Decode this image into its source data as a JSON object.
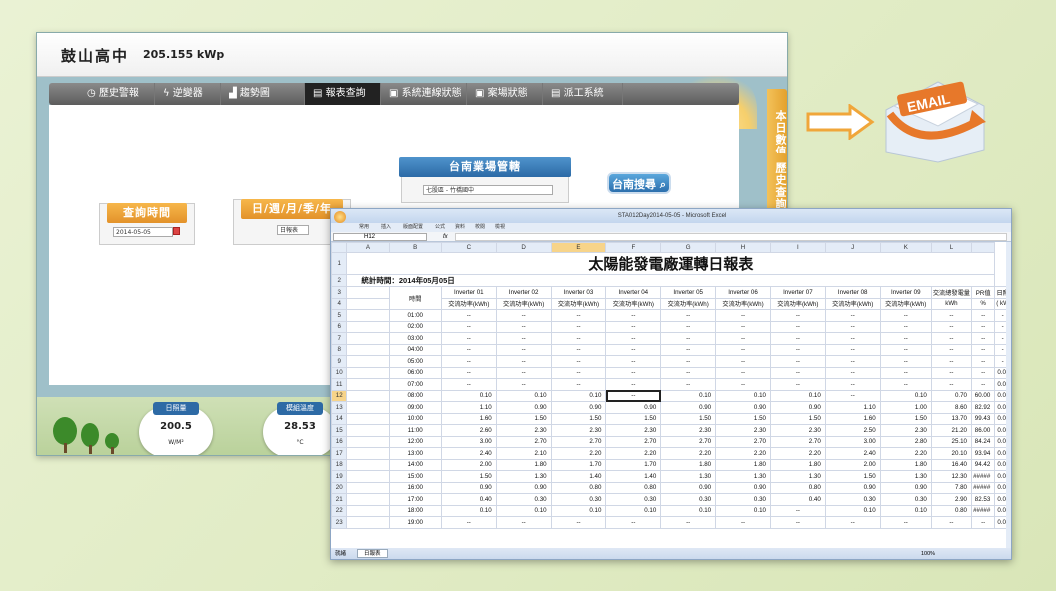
{
  "app": {
    "title": "鼓山高中",
    "kwp": "205.155 kWp"
  },
  "nav": [
    "歷史警報",
    "逆變器",
    "趨勢圖",
    "報表查詢",
    "系統連線狀態",
    "案場狀態",
    "派工系統"
  ],
  "nav_icons": [
    "clock-icon",
    "bolt-icon",
    "chart-icon",
    "report-icon",
    "link-icon",
    "site-icon",
    "worker-icon"
  ],
  "side_tabs": [
    "本日數值",
    "歷史查詢"
  ],
  "query_time": {
    "label": "查詢時間",
    "value": "2014-05-05"
  },
  "period": {
    "label": "日/週/月/季/年",
    "value": "日報表"
  },
  "region": {
    "label": "台南業場管轄",
    "value": "七股區 - 竹橋國中"
  },
  "search_button": "台南搜尋",
  "gauges": [
    {
      "label": "日照量",
      "value": "200.5",
      "unit": "W/M²"
    },
    {
      "label": "模組溫度",
      "value": "28.53",
      "unit": "°C"
    }
  ],
  "email": "EMAIL",
  "excel": {
    "window_title": "STA012Day2014-05-05 - Microsoft Excel",
    "ribbon": [
      "常用",
      "插入",
      "版面配置",
      "公式",
      "資料",
      "校閱",
      "檢視"
    ],
    "namebox": "H12",
    "fx": "fx",
    "columns": [
      "A",
      "B",
      "C",
      "D",
      "E",
      "F",
      "G",
      "H",
      "I",
      "J",
      "K",
      "L"
    ],
    "title": "太陽能發電廠運轉日報表",
    "stat_time": "統計時間：2014年05月05日",
    "time_header": "時間",
    "inverters": [
      "Inverter 01",
      "Inverter 02",
      "Inverter 03",
      "Inverter 04",
      "Inverter 05",
      "Inverter 06",
      "Inverter 07",
      "Inverter 08",
      "Inverter 09"
    ],
    "total_header": "交流總發電量",
    "pr_header": "PR值",
    "sun_header": "日照",
    "unit_kwh": "交流功率(kWh)",
    "unit_total": "kWh",
    "unit_pr": "%",
    "unit_sun": "( kW",
    "rows": [
      {
        "n": "5",
        "t": "01:00",
        "v": [
          "--",
          "--",
          "--",
          "--",
          "--",
          "--",
          "--",
          "--",
          "--",
          "--",
          "--",
          "-"
        ]
      },
      {
        "n": "6",
        "t": "02:00",
        "v": [
          "--",
          "--",
          "--",
          "--",
          "--",
          "--",
          "--",
          "--",
          "--",
          "--",
          "--",
          "-"
        ]
      },
      {
        "n": "7",
        "t": "03:00",
        "v": [
          "--",
          "--",
          "--",
          "--",
          "--",
          "--",
          "--",
          "--",
          "--",
          "--",
          "--",
          "-"
        ]
      },
      {
        "n": "8",
        "t": "04:00",
        "v": [
          "--",
          "--",
          "--",
          "--",
          "--",
          "--",
          "--",
          "--",
          "--",
          "--",
          "--",
          "-"
        ]
      },
      {
        "n": "9",
        "t": "05:00",
        "v": [
          "--",
          "--",
          "--",
          "--",
          "--",
          "--",
          "--",
          "--",
          "--",
          "--",
          "--",
          "-"
        ]
      },
      {
        "n": "10",
        "t": "06:00",
        "v": [
          "--",
          "--",
          "--",
          "--",
          "--",
          "--",
          "--",
          "--",
          "--",
          "--",
          "--",
          "0.0"
        ]
      },
      {
        "n": "11",
        "t": "07:00",
        "v": [
          "--",
          "--",
          "--",
          "--",
          "--",
          "--",
          "--",
          "--",
          "--",
          "--",
          "--",
          "0.0"
        ]
      },
      {
        "n": "12",
        "t": "08:00",
        "v": [
          "0.10",
          "0.10",
          "0.10",
          "--",
          "0.10",
          "0.10",
          "0.10",
          "--",
          "0.10",
          "0.70",
          "60.00",
          "0.0"
        ]
      },
      {
        "n": "13",
        "t": "09:00",
        "v": [
          "1.10",
          "0.90",
          "0.90",
          "0.90",
          "0.90",
          "0.90",
          "0.90",
          "1.10",
          "1.00",
          "8.60",
          "82.92",
          "0.0"
        ]
      },
      {
        "n": "14",
        "t": "10:00",
        "v": [
          "1.60",
          "1.50",
          "1.50",
          "1.50",
          "1.50",
          "1.50",
          "1.50",
          "1.60",
          "1.50",
          "13.70",
          "99.43",
          "0.0"
        ]
      },
      {
        "n": "15",
        "t": "11:00",
        "v": [
          "2.60",
          "2.30",
          "2.30",
          "2.30",
          "2.30",
          "2.30",
          "2.30",
          "2.50",
          "2.30",
          "21.20",
          "86.00",
          "0.0"
        ]
      },
      {
        "n": "16",
        "t": "12:00",
        "v": [
          "3.00",
          "2.70",
          "2.70",
          "2.70",
          "2.70",
          "2.70",
          "2.70",
          "3.00",
          "2.80",
          "25.10",
          "84.24",
          "0.0"
        ]
      },
      {
        "n": "17",
        "t": "13:00",
        "v": [
          "2.40",
          "2.10",
          "2.20",
          "2.20",
          "2.20",
          "2.20",
          "2.20",
          "2.40",
          "2.20",
          "20.10",
          "93.94",
          "0.0"
        ]
      },
      {
        "n": "18",
        "t": "14:00",
        "v": [
          "2.00",
          "1.80",
          "1.70",
          "1.70",
          "1.80",
          "1.80",
          "1.80",
          "2.00",
          "1.80",
          "16.40",
          "94.42",
          "0.0"
        ]
      },
      {
        "n": "19",
        "t": "15:00",
        "v": [
          "1.50",
          "1.30",
          "1.40",
          "1.40",
          "1.30",
          "1.30",
          "1.30",
          "1.50",
          "1.30",
          "12.30",
          "#####",
          "0.0"
        ]
      },
      {
        "n": "20",
        "t": "16:00",
        "v": [
          "0.90",
          "0.90",
          "0.80",
          "0.80",
          "0.90",
          "0.90",
          "0.80",
          "0.90",
          "0.90",
          "7.80",
          "#####",
          "0.0"
        ]
      },
      {
        "n": "21",
        "t": "17:00",
        "v": [
          "0.40",
          "0.30",
          "0.30",
          "0.30",
          "0.30",
          "0.30",
          "0.40",
          "0.30",
          "0.30",
          "2.90",
          "82.53",
          "0.0"
        ]
      },
      {
        "n": "22",
        "t": "18:00",
        "v": [
          "0.10",
          "0.10",
          "0.10",
          "0.10",
          "0.10",
          "0.10",
          "--",
          "0.10",
          "0.10",
          "0.80",
          "#####",
          "0.0"
        ]
      },
      {
        "n": "23",
        "t": "19:00",
        "v": [
          "--",
          "--",
          "--",
          "--",
          "--",
          "--",
          "--",
          "--",
          "--",
          "--",
          "--",
          "0.0"
        ]
      }
    ],
    "status": "就緒",
    "sheet_tab": "日報表",
    "zoom": "100%"
  }
}
